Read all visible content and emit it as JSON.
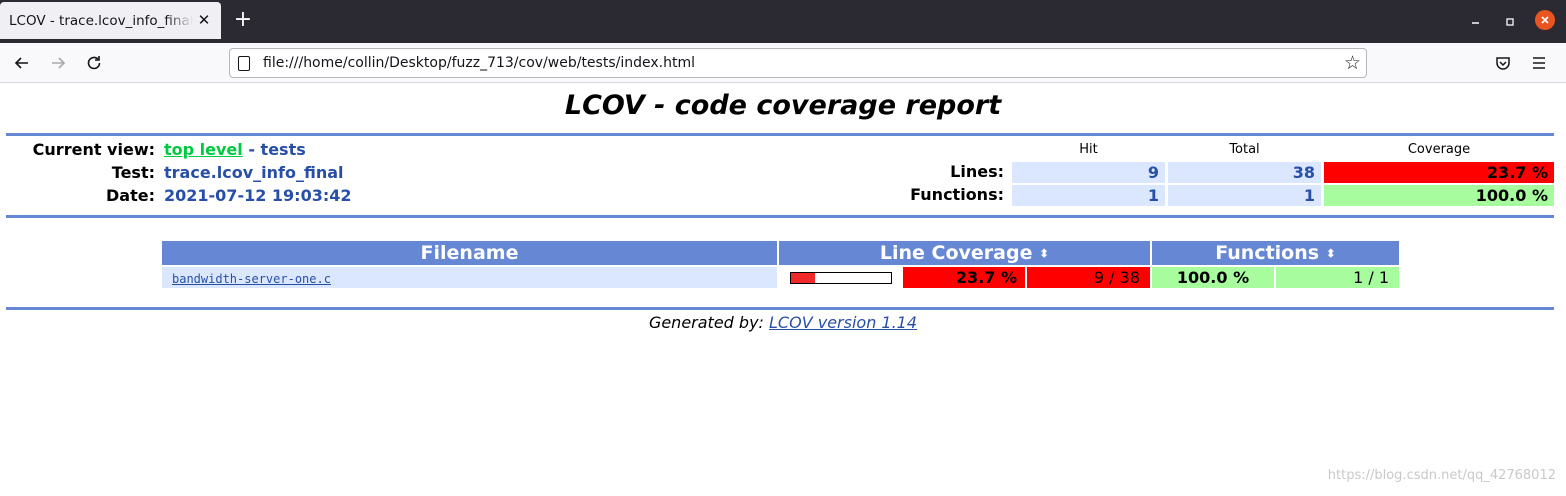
{
  "browser": {
    "tab_title": "LCOV - trace.lcov_info_final",
    "tab_close": "✕",
    "new_tab": "+",
    "url": "file:///home/collin/Desktop/fuzz_713/cov/web/tests/index.html",
    "icons": [
      "back-arrow-icon",
      "forward-arrow-icon",
      "reload-icon",
      "page-icon",
      "bookmark-star-icon",
      "pocket-icon",
      "hamburger-menu-icon",
      "minimize-icon",
      "maximize-icon",
      "close-icon"
    ]
  },
  "report": {
    "title": "LCOV - code coverage report",
    "header": {
      "current_view_label": "Current view:",
      "current_view_link": "top level",
      "current_view_sep": " - ",
      "current_view_dir": "tests",
      "test_label": "Test:",
      "test_value": "trace.lcov_info_final",
      "date_label": "Date:",
      "date_value": "2021-07-12 19:03:42"
    },
    "summary": {
      "col_hit": "Hit",
      "col_total": "Total",
      "col_coverage": "Coverage",
      "lines_label": "Lines:",
      "lines_hit": "9",
      "lines_total": "38",
      "lines_coverage": "23.7 %",
      "functions_label": "Functions:",
      "functions_hit": "1",
      "functions_total": "1",
      "functions_coverage": "100.0 %"
    },
    "table": {
      "col_filename": "Filename",
      "col_line_coverage": "Line Coverage",
      "col_functions": "Functions",
      "sort_glyph": "⬍",
      "rows": [
        {
          "filename": "bandwidth-server-one.c",
          "line_coverage_fraction": 0.237,
          "line_pct": "23.7 %",
          "line_frac": "9 / 38",
          "func_pct": "100.0 %",
          "func_frac": "1 / 1"
        }
      ]
    },
    "footer": {
      "prefix": "Generated by: ",
      "link": "LCOV version 1.14"
    }
  },
  "watermark": "https://blog.csdn.net/qq_42768012",
  "colors": {
    "ruler": "#6688d4",
    "value_blue": "#284fa8",
    "cell_blue": "#dae7fe",
    "low_red": "#ff0000",
    "high_green": "#a7fc9d",
    "link_green": "#00cb40"
  }
}
